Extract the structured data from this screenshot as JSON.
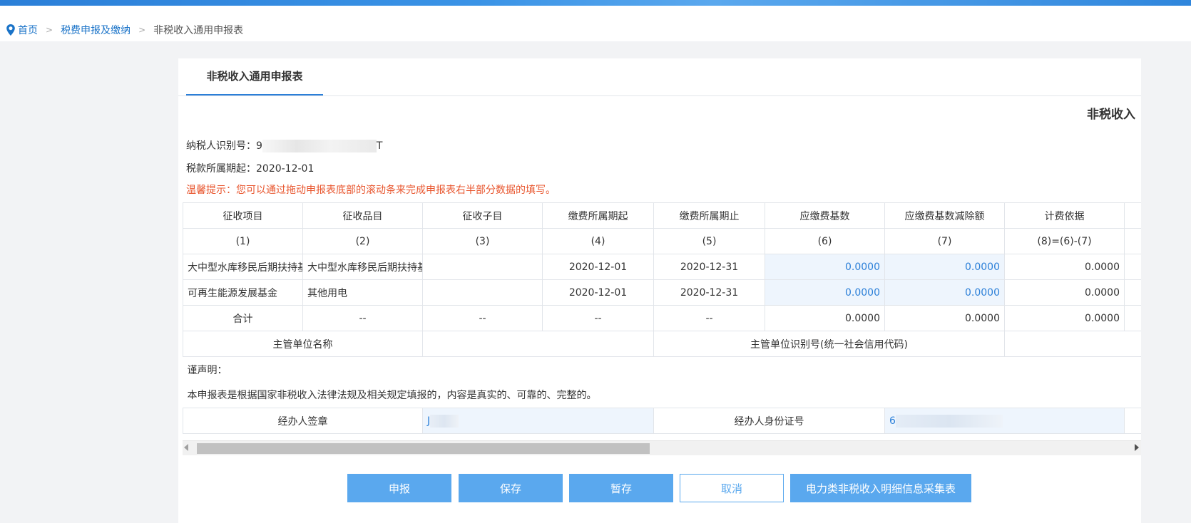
{
  "breadcrumb": {
    "home": "首页",
    "level1": "税费申报及缴纳",
    "current": "非税收入通用申报表",
    "sep": ">"
  },
  "tab": {
    "label": "非税收入通用申报表"
  },
  "corner_title": "非税收入",
  "info": {
    "taxpayer_id_label": "纳税人识别号：",
    "taxpayer_id_prefix": "9",
    "taxpayer_id_suffix": "T",
    "period_label": "税款所属期起：",
    "period_value": "2020-12-01"
  },
  "tip": "温馨提示：您可以通过拖动申报表底部的滚动条来完成申报表右半部分数据的填写。",
  "table": {
    "headers": [
      "征收项目",
      "征收品目",
      "征收子目",
      "缴费所属期起",
      "缴费所属期止",
      "应缴费基数",
      "应缴费基数减除额",
      "计费依据"
    ],
    "col_numbers": [
      "(1)",
      "(2)",
      "(3)",
      "(4)",
      "(5)",
      "(6)",
      "(7)",
      "(8)=(6)-(7)"
    ],
    "rows": [
      [
        "大中型水库移民后期扶持基金",
        "大中型水库移民后期扶持基金",
        "",
        "2020-12-01",
        "2020-12-31",
        "0.0000",
        "0.0000",
        "0.0000"
      ],
      [
        "可再生能源发展基金",
        "其他用电",
        "",
        "2020-12-01",
        "2020-12-31",
        "0.0000",
        "0.0000",
        "0.0000"
      ]
    ],
    "total": [
      "合计",
      "--",
      "--",
      "--",
      "--",
      "0.0000",
      "0.0000",
      "0.0000"
    ],
    "authority_name_label": "主管单位名称",
    "authority_name_value": "",
    "authority_id_label": "主管单位识别号(统一社会信用代码)",
    "authority_id_value": "",
    "declaration_title": "谨声明：",
    "declaration_text": "本申报表是根据国家非税收入法律法规及相关规定填报的，内容是真实的、可靠的、完整的。",
    "agent_sign_label": "经办人签章",
    "agent_sign_prefix": "J",
    "agent_id_label": "经办人身份证号",
    "agent_id_prefix": "6"
  },
  "buttons": {
    "submit": "申报",
    "save": "保存",
    "temp_save": "暂存",
    "cancel": "取消",
    "power_form": "电力类非税收入明细信息采集表"
  },
  "colors": {
    "primary": "#5aa8ee",
    "link": "#1a73c8",
    "tip": "#e8552d"
  }
}
